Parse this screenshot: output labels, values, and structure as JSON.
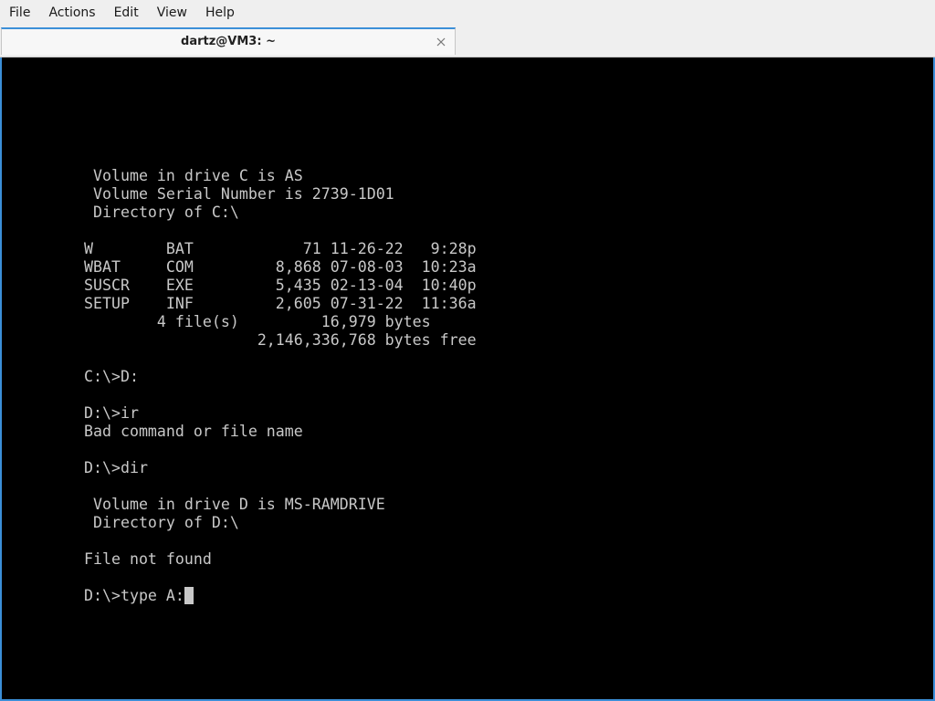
{
  "menubar": {
    "items": [
      "File",
      "Actions",
      "Edit",
      "View",
      "Help"
    ]
  },
  "tab": {
    "title": "dartz@VM3: ~",
    "close_icon": "close-icon"
  },
  "terminal": {
    "lines": [
      " Volume in drive C is AS",
      " Volume Serial Number is 2739-1D01",
      " Directory of C:\\",
      "",
      "W        BAT            71 11-26-22   9:28p",
      "WBAT     COM         8,868 07-08-03  10:23a",
      "SUSCR    EXE         5,435 02-13-04  10:40p",
      "SETUP    INF         2,605 07-31-22  11:36a",
      "        4 file(s)         16,979 bytes",
      "                   2,146,336,768 bytes free",
      "",
      "C:\\>D:",
      "",
      "D:\\>ir",
      "Bad command or file name",
      "",
      "D:\\>dir",
      "",
      " Volume in drive D is MS-RAMDRIVE",
      " Directory of D:\\",
      "",
      "File not found",
      ""
    ],
    "prompt": "D:\\>type A:"
  },
  "colors": {
    "terminal_bg": "#000000",
    "terminal_fg": "#c8c8c8",
    "accent": "#3b8fd8"
  }
}
